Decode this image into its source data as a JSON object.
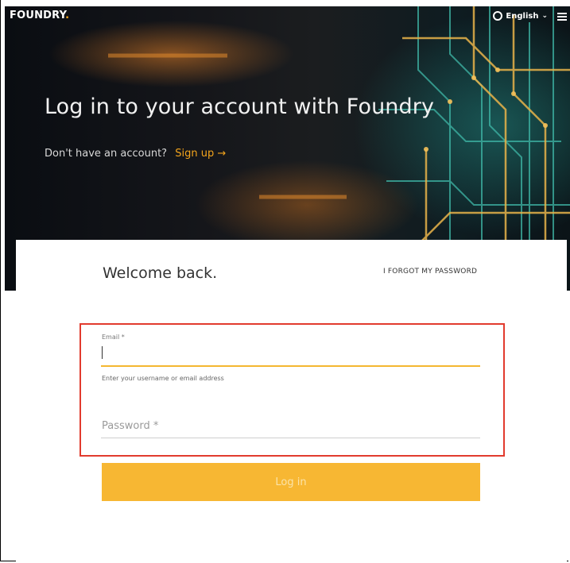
{
  "brand": {
    "name": "FOUNDRY",
    "dot": "."
  },
  "header": {
    "language": "English"
  },
  "hero": {
    "title": "Log in to your account with Foundry",
    "signup_prompt": "Don't have an account?",
    "signup_link": "Sign up →"
  },
  "form": {
    "welcome": "Welcome back.",
    "forgot_password": "I FORGOT MY PASSWORD",
    "email_label": "Email *",
    "email_value": "",
    "email_hint": "Enter your username or email address",
    "password_placeholder": "Password *",
    "submit_label": "Log in"
  },
  "colors": {
    "accent": "#f7b733",
    "highlight_border": "#e23b2e",
    "hero_dark": "#0e1418"
  },
  "icons": [
    "globe-icon",
    "chevron-down-icon",
    "menu-icon",
    "arrow-right-icon"
  ]
}
